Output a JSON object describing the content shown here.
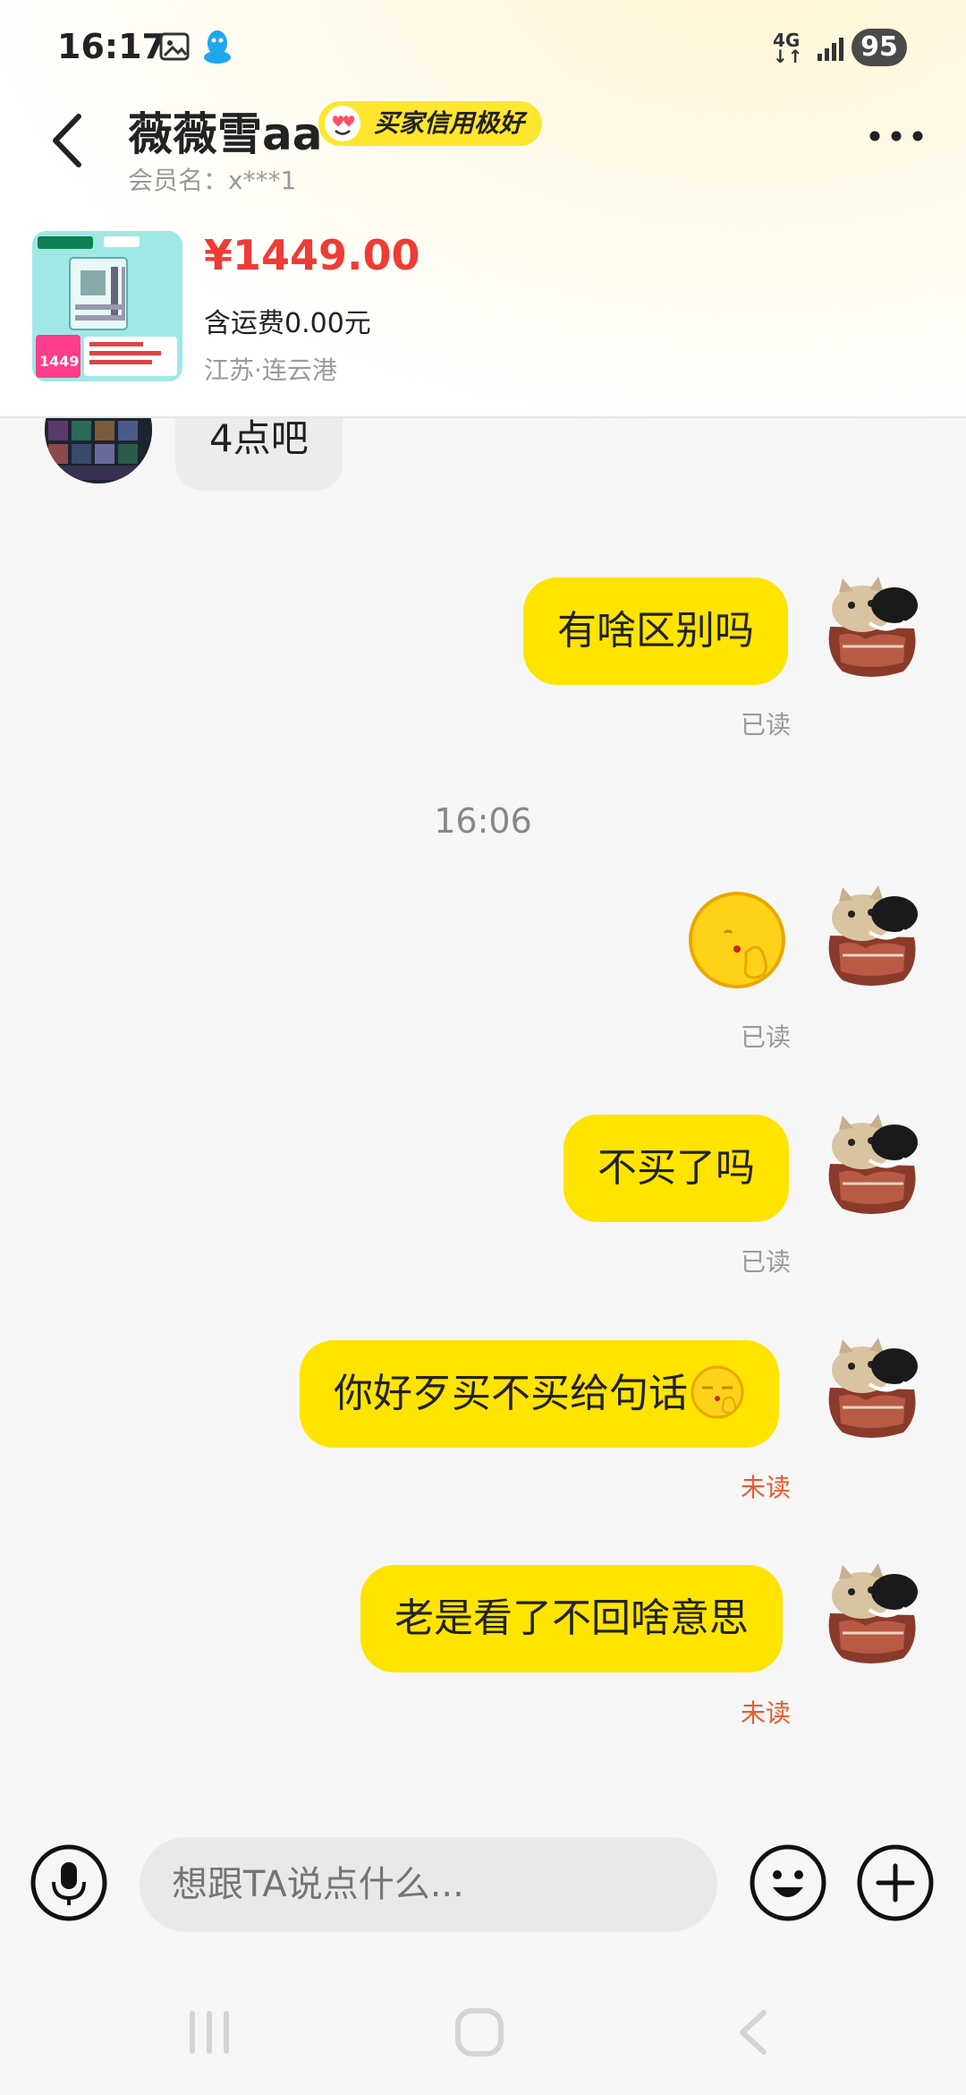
{
  "status_bar": {
    "time": "16:17",
    "network": "4G",
    "battery": "95"
  },
  "header": {
    "nickname": "薇薇雪aa",
    "badge": "买家信用极好",
    "member": "会员名：x***1"
  },
  "product": {
    "price": "¥1449.00",
    "shipping": "含运费0.00元",
    "location": "江苏·连云港",
    "thumb_tag": "1449"
  },
  "messages": [
    {
      "side": "in",
      "text": "4点吧"
    },
    {
      "side": "out",
      "text": "有啥区别吗",
      "status": "已读"
    },
    {
      "side": "time",
      "text": "16:06"
    },
    {
      "side": "out",
      "emoji": "blowing-kiss-emoji",
      "status": "已读"
    },
    {
      "side": "out",
      "text": "不买了吗",
      "status": "已读"
    },
    {
      "side": "out",
      "text": "你好歹买不买给句话",
      "status": "未读"
    },
    {
      "side": "out",
      "text": "老是看了不回啥意思",
      "status": "未读"
    }
  ],
  "input": {
    "placeholder": "想跟TA说点什么..."
  },
  "colors": {
    "bubble": "#ffe400",
    "price": "#ef3b36",
    "unread": "#ea5a2f"
  },
  "icons": [
    "back-icon",
    "more-icon",
    "mic-icon",
    "emoji-icon",
    "plus-icon"
  ]
}
